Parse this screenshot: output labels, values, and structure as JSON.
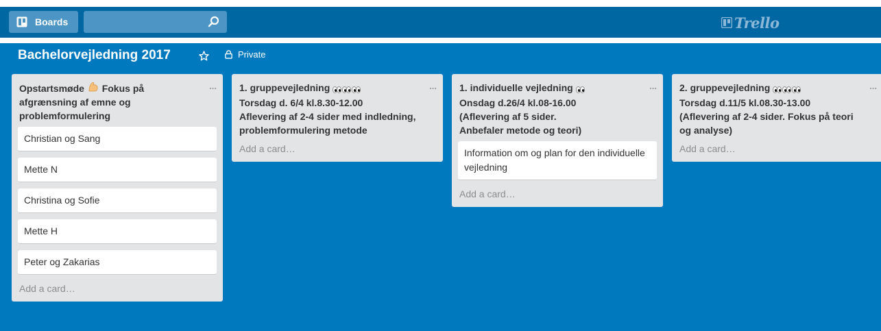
{
  "app": {
    "logo_text": "Trello"
  },
  "header": {
    "boards_label": "Boards",
    "search": {
      "value": "",
      "placeholder": ""
    }
  },
  "board": {
    "title": "Bachelorvejledning 2017",
    "visibility": "Private"
  },
  "icons": {
    "boards": "boards-icon",
    "search": "search-icon",
    "star": "star-icon",
    "lock": "lock-icon",
    "list_menu": "ellipsis-icon",
    "flexed_biceps": "flexed-biceps-emoji",
    "eyes": "eyes-emoji"
  },
  "lists": [
    {
      "title_parts": [
        "Opstartsmøde ",
        " Fokus på afgrænsning af emne og problemformulering"
      ],
      "menu": "...",
      "cards": [
        "Christian og Sang",
        "Mette N",
        "Christina og Sofie",
        "Mette H",
        "Peter og Zakarias"
      ],
      "add_card": "Add a card…"
    },
    {
      "title_parts": [
        "1. gruppevejledning ",
        "\nTorsdag d. 6/4 kl.8.30-12.00\nAflevering af 2-4 sider med indledning, problemformulering metode"
      ],
      "menu": "...",
      "cards": [],
      "add_card": "Add a card…"
    },
    {
      "title_parts": [
        "1. individuelle vejledning ",
        "\nOnsdag d.26/4 kl.08-16.00\n(Aflevering af 5 sider.\nAnbefaler metode og teori)"
      ],
      "menu": "...",
      "cards": [
        "Information om og plan for den individuelle vejledning"
      ],
      "add_card": "Add a card…"
    },
    {
      "title_parts": [
        "2. gruppevejledning ",
        "\nTorsdag d.11/5 kl.08.30-13.00\n(Aflevering af 2-4 sider. Fokus på teori og analyse)"
      ],
      "menu": "...",
      "cards": [],
      "add_card": "Add a card…"
    }
  ],
  "colors": {
    "board_background": "#0079BF",
    "header_background": "#0067A3",
    "list_background": "#E2E4E6",
    "card_background": "#FFFFFF"
  }
}
